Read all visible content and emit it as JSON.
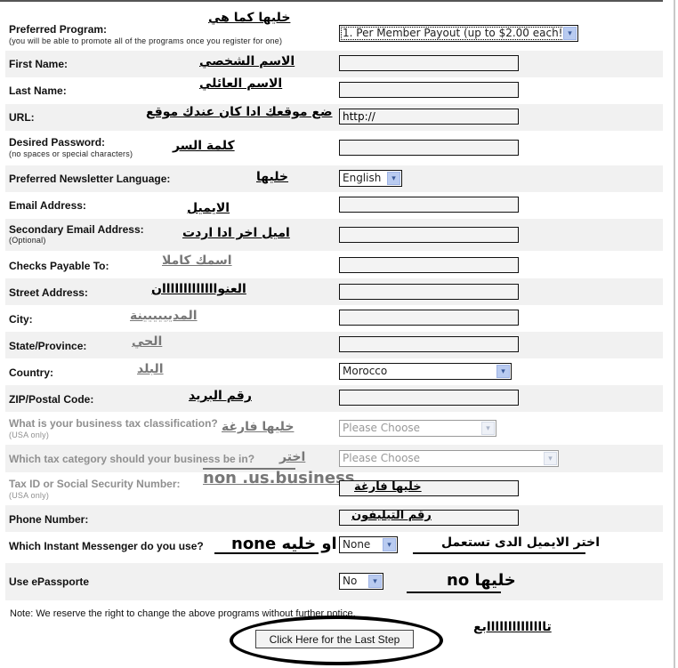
{
  "form": {
    "rows": [
      {
        "label": "Preferred Program:",
        "sub": "(you will be able to promote all of the programs once you register for one)",
        "annotation": "خليها كما هي",
        "control": {
          "type": "select",
          "value": "1. Per Member Payout (up to $2.00 each!)"
        }
      },
      {
        "label": "First Name:",
        "annotation": "الاسم الشخصي",
        "control": {
          "type": "text",
          "value": ""
        }
      },
      {
        "label": "Last Name:",
        "annotation": "الاسم العائلي",
        "control": {
          "type": "text",
          "value": ""
        }
      },
      {
        "label": "URL:",
        "annotation": "ضع موقعك ادا كان عندك موقع",
        "control": {
          "type": "text",
          "value": "http://"
        }
      },
      {
        "label": "Desired Password:",
        "sub": "(no spaces or special characters)",
        "annotation": "كلمة السر",
        "control": {
          "type": "text",
          "value": ""
        }
      },
      {
        "label": "Preferred Newsletter Language:",
        "annotation": "خليها",
        "control": {
          "type": "select",
          "value": "English"
        }
      },
      {
        "label": "Email Address:",
        "annotation": "الايميل",
        "control": {
          "type": "text",
          "value": ""
        }
      },
      {
        "label": "Secondary Email Address:",
        "sub": "(Optional)",
        "annotation": "اميل اخر ادا اردت",
        "control": {
          "type": "text",
          "value": ""
        }
      },
      {
        "label": "Checks Payable To:",
        "annotation": "اسمك كاملا",
        "control": {
          "type": "text",
          "value": ""
        }
      },
      {
        "label": "Street Address:",
        "annotation": "العنوااااااااااااان",
        "control": {
          "type": "text",
          "value": ""
        }
      },
      {
        "label": "City:",
        "annotation": "المديييييينة",
        "control": {
          "type": "text",
          "value": ""
        }
      },
      {
        "label": "State/Province:",
        "annotation": "الحي",
        "control": {
          "type": "text",
          "value": ""
        }
      },
      {
        "label": "Country:",
        "annotation": "البلد",
        "control": {
          "type": "select",
          "value": "Morocco"
        }
      },
      {
        "label": "ZIP/Postal Code:",
        "annotation": "رقم البريد",
        "control": {
          "type": "text",
          "value": ""
        }
      },
      {
        "label": "What is your business tax classification?",
        "sub": "(USA only)",
        "annotation": "خليها فارغة",
        "control": {
          "type": "select",
          "value": "Please Choose",
          "disabled": true
        }
      },
      {
        "label": "Which tax category should your business be in?",
        "annotation": "اختر",
        "annotation2": "non .us.business",
        "control": {
          "type": "select",
          "value": "Please Choose",
          "disabled": true
        }
      },
      {
        "label": "Tax ID or Social Security Number:",
        "sub": "(USA only)",
        "annotation": "خليها فارغة",
        "control": {
          "type": "text",
          "value": ""
        }
      },
      {
        "label": "Phone Number:",
        "annotation": "رقم التيليفون",
        "control": {
          "type": "text",
          "value": ""
        }
      },
      {
        "label": "Which Instant Messenger do you use?",
        "annotation": "none او خليه",
        "annotation_right": "اختر الايميل الدى تستعمل",
        "control": {
          "type": "select",
          "value": "None"
        }
      },
      {
        "label": "Use ePassporte",
        "annotation_right": "خليها no",
        "control": {
          "type": "select",
          "value": "No"
        }
      }
    ],
    "note": "Note: We reserve the right to change the above programs without further notice.",
    "submit_label": "Click Here for the Last Step",
    "submit_annotation": "تاااااااااااااابع"
  },
  "icons": {
    "dropdown": "▾"
  },
  "colors": {
    "row_alt": "#f1f1f1",
    "dim_text": "#8f8f8f",
    "dropdown_arrow_bg": "#b9cbf0"
  }
}
